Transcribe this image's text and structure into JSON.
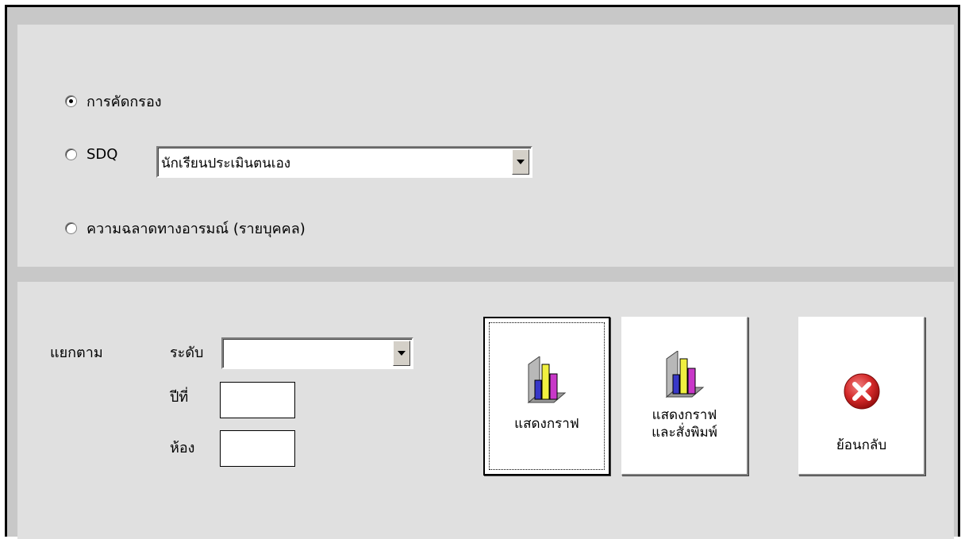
{
  "report_type": {
    "options": [
      {
        "label": "การคัดกรอง",
        "checked": true
      },
      {
        "label": "SDQ",
        "checked": false
      },
      {
        "label": "ความฉลาดทางอารมณ์ (รายบุคคล)",
        "checked": false
      }
    ],
    "sdq_assessor": "นักเรียนประเมินตนเอง"
  },
  "filter": {
    "group_label": "แยกตาม",
    "level_label": "ระดับ",
    "level_value": "",
    "year_label": "ปีที่",
    "year_value": "",
    "room_label": "ห้อง",
    "room_value": ""
  },
  "buttons": {
    "show_graph": "แสดงกราฟ",
    "show_print_line1": "แสดงกราฟ",
    "show_print_line2": "และสั่งพิมพ์",
    "back": "ย้อนกลับ"
  },
  "icons": {
    "graph": "bar-chart-icon",
    "back": "close-circle-icon"
  },
  "colors": {
    "panel": "#e0e0e0",
    "frame": "#c8c8c8",
    "close_red": "#d42a2a"
  }
}
